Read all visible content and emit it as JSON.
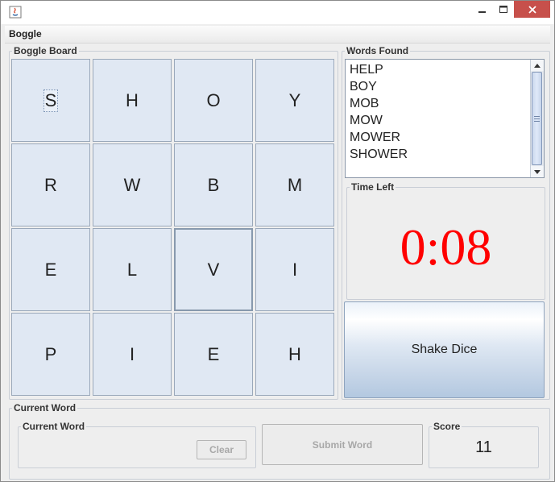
{
  "window": {
    "menu": [
      "Boggle"
    ]
  },
  "board": {
    "legend": "Boggle Board",
    "cells": [
      "S",
      "H",
      "O",
      "Y",
      "R",
      "W",
      "B",
      "M",
      "E",
      "L",
      "V",
      "I",
      "P",
      "I",
      "E",
      "H"
    ],
    "selected_cell": "S",
    "focused_cell": "V"
  },
  "words_found": {
    "legend": "Words Found",
    "items": [
      "HELP",
      "BOY",
      "MOB",
      "MOW",
      "MOWER",
      "SHOWER"
    ]
  },
  "time_left": {
    "legend": "Time Left",
    "value": "0:08",
    "color": "#ff0000"
  },
  "shake_button": {
    "label": "Shake Dice"
  },
  "current_word": {
    "legend": "Current Word",
    "sub_legend": "Current Word",
    "value": "",
    "clear_label": "Clear",
    "submit_label": "Submit Word"
  },
  "score": {
    "legend": "Score",
    "value": "11"
  },
  "colors": {
    "accent_close": "#c7504b",
    "cell_bg": "#e0e8f3"
  }
}
